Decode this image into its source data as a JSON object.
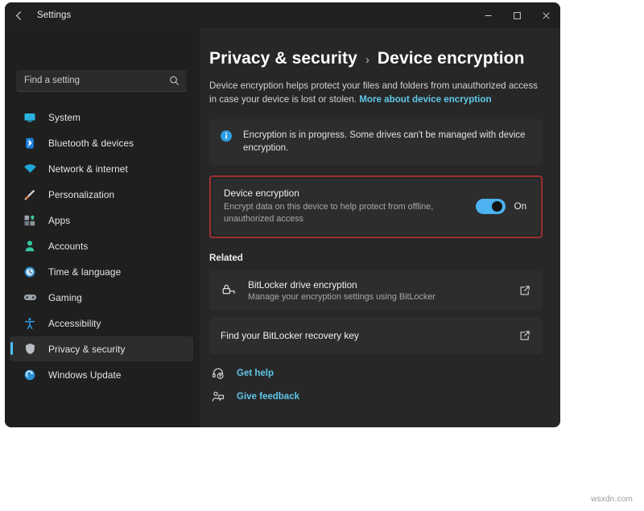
{
  "window": {
    "title": "Settings",
    "back_icon": "back-arrow-icon",
    "controls": {
      "minimize": "minimize-icon",
      "maximize": "maximize-icon",
      "close": "close-icon"
    }
  },
  "search": {
    "placeholder": "Find a setting",
    "value": "",
    "icon": "search-icon"
  },
  "sidebar": {
    "items": [
      {
        "label": "System",
        "icon": "monitor-icon",
        "selected": false
      },
      {
        "label": "Bluetooth & devices",
        "icon": "bluetooth-icon",
        "selected": false
      },
      {
        "label": "Network & internet",
        "icon": "wifi-icon",
        "selected": false
      },
      {
        "label": "Personalization",
        "icon": "paintbrush-icon",
        "selected": false
      },
      {
        "label": "Apps",
        "icon": "apps-grid-icon",
        "selected": false
      },
      {
        "label": "Accounts",
        "icon": "person-icon",
        "selected": false
      },
      {
        "label": "Time & language",
        "icon": "clock-icon",
        "selected": false
      },
      {
        "label": "Gaming",
        "icon": "gamepad-icon",
        "selected": false
      },
      {
        "label": "Accessibility",
        "icon": "accessibility-person-icon",
        "selected": false
      },
      {
        "label": "Privacy & security",
        "icon": "shield-icon",
        "selected": true
      },
      {
        "label": "Windows Update",
        "icon": "update-refresh-icon",
        "selected": false
      }
    ]
  },
  "main": {
    "breadcrumb": {
      "root": "Privacy & security",
      "separator": "›",
      "current": "Device encryption"
    },
    "description": {
      "text": "Device encryption helps protect your files and folders from unauthorized access in case your device is lost or stolen.",
      "link_text": "More about device encryption"
    },
    "info_banner": {
      "icon": "info-circle-icon",
      "text": "Encryption is in progress. Some drives can't be managed with device encryption."
    },
    "device_encryption": {
      "title": "Device encryption",
      "subtitle": "Encrypt data on this device to help protect from offline, unauthorized access",
      "toggle_state": "On",
      "toggle_on": true,
      "highlight_color": "#9e3030",
      "toggle_color": "#4cb2f0"
    },
    "related": {
      "heading": "Related",
      "items": [
        {
          "title": "BitLocker drive encryption",
          "subtitle": "Manage your encryption settings using BitLocker",
          "icon": "drive-lock-icon",
          "action_icon": "external-link-icon"
        },
        {
          "title": "Find your BitLocker recovery key",
          "subtitle": "",
          "icon": "",
          "action_icon": "external-link-icon"
        }
      ]
    },
    "footer_links": [
      {
        "label": "Get help",
        "icon": "help-headset-icon"
      },
      {
        "label": "Give feedback",
        "icon": "feedback-person-icon"
      }
    ]
  },
  "watermark": "wsxdn.com"
}
